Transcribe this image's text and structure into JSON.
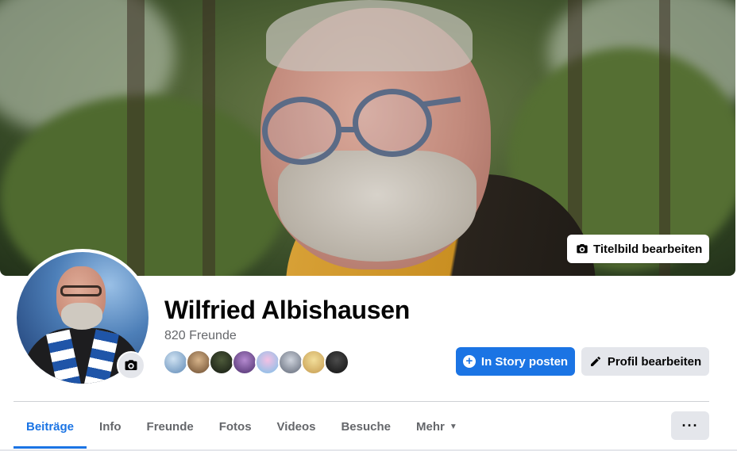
{
  "cover": {
    "edit_button_label": "Titelbild bearbeiten",
    "icon": "camera-icon"
  },
  "profile": {
    "name": "Wilfried Albishausen",
    "friends_count_text": "820 Freunde",
    "avatar_edit_icon": "camera-icon",
    "friend_faces_count": 8
  },
  "actions": {
    "story_button_label": "In Story posten",
    "story_icon": "plus-circle-icon",
    "edit_profile_label": "Profil bearbeiten",
    "edit_profile_icon": "pencil-icon",
    "more_label": "···"
  },
  "tabs": [
    {
      "label": "Beiträge",
      "active": true
    },
    {
      "label": "Info",
      "active": false
    },
    {
      "label": "Freunde",
      "active": false
    },
    {
      "label": "Fotos",
      "active": false
    },
    {
      "label": "Videos",
      "active": false
    },
    {
      "label": "Besuche",
      "active": false
    },
    {
      "label": "Mehr",
      "active": false,
      "dropdown": true
    }
  ],
  "colors": {
    "accent": "#1b74e4",
    "secondary_button": "#e4e6eb",
    "text_primary": "#050505",
    "text_secondary": "#65676b"
  }
}
